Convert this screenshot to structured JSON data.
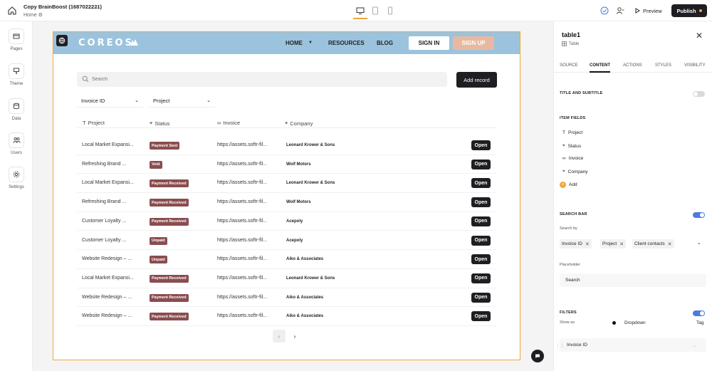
{
  "topbar": {
    "project_title": "Copy BrainBoost (1687022221)",
    "page_name": "Home",
    "preview_label": "Preview",
    "publish_label": "Publish"
  },
  "rail": {
    "items": [
      {
        "label": "Pages",
        "icon": "pages-icon"
      },
      {
        "label": "Theme",
        "icon": "theme-icon"
      },
      {
        "label": "Data",
        "icon": "database-icon"
      },
      {
        "label": "Users",
        "icon": "users-icon"
      },
      {
        "label": "Settings",
        "icon": "gear-icon"
      }
    ]
  },
  "site": {
    "logo_text": "COREOS",
    "nav": {
      "home": "HOME",
      "resources": "RESOURCES",
      "blog": "BLOG",
      "sign_in": "SIGN IN",
      "sign_up": "SIGN UP"
    },
    "search_placeholder": "Search",
    "add_record": "Add record",
    "filters": [
      "Invoice ID",
      "Project"
    ],
    "columns": [
      "Project",
      "Status",
      "Invoice",
      "Company"
    ],
    "open_label": "Open",
    "rows": [
      {
        "project": "Local Market Expansi...",
        "status": "Payment Sent",
        "invoice": "https://assets.softr-fil...",
        "company": "Leonard Krower & Sons"
      },
      {
        "project": "Refreshing Brand ...",
        "status": "Void",
        "invoice": "https://assets.softr-fil...",
        "company": "Wolf Motors"
      },
      {
        "project": "Local Market Expansi...",
        "status": "Payment Received",
        "invoice": "https://assets.softr-fil...",
        "company": "Leonard Krower & Sons"
      },
      {
        "project": "Refreshing Brand ...",
        "status": "Payment Received",
        "invoice": "https://assets.softr-fil...",
        "company": "Wolf Motors"
      },
      {
        "project": "Customer Loyalty ...",
        "status": "Payment Received",
        "invoice": "https://assets.softr-fil...",
        "company": "Acepoly"
      },
      {
        "project": "Customer Loyalty ...",
        "status": "Unpaid",
        "invoice": "https://assets.softr-fil...",
        "company": "Acepoly"
      },
      {
        "project": "Website Redesign – ...",
        "status": "Unpaid",
        "invoice": "https://assets.softr-fil...",
        "company": "Aiko & Associates"
      },
      {
        "project": "Local Market Expansi...",
        "status": "Payment Received",
        "invoice": "https://assets.softr-fil...",
        "company": "Leonard Krower & Sons"
      },
      {
        "project": "Website Redesign – ...",
        "status": "Payment Received",
        "invoice": "https://assets.softr-fil...",
        "company": "Aiko & Associates"
      },
      {
        "project": "Website Redesign – ...",
        "status": "Payment Received",
        "invoice": "https://assets.softr-fil...",
        "company": "Aiko & Associates"
      }
    ]
  },
  "panel": {
    "title": "table1",
    "subtitle": "Table",
    "tabs": [
      "SOURCE",
      "CONTENT",
      "ACTIONS",
      "STYLES",
      "VISIBILITY"
    ],
    "active_tab": "CONTENT",
    "title_subtitle_label": "TITLE AND SUBTITLE",
    "title_subtitle_enabled": false,
    "item_fields_label": "ITEM FIELDS",
    "item_fields": [
      "Project",
      "Status",
      "Invoice",
      "Company"
    ],
    "add_label": "Add",
    "search_bar_label": "SEARCH BAR",
    "search_bar_enabled": true,
    "search_by_label": "Search by",
    "search_by": [
      "Invoice ID",
      "Project",
      "Client contacts"
    ],
    "placeholder_label": "Placeholder",
    "placeholder_value": "Search",
    "filters_label": "FILTERS",
    "filters_enabled": true,
    "show_as_label": "Show as",
    "show_as_options": [
      "Dropdown",
      "Tag"
    ],
    "show_as_selected": "Dropdown",
    "filter_item": "Invoice ID"
  },
  "colors": {
    "accent": "#f0a63a",
    "nav_bg": "#9cc3dd",
    "badge": "#8a4d4f",
    "toggle_on": "#4a7cde"
  }
}
